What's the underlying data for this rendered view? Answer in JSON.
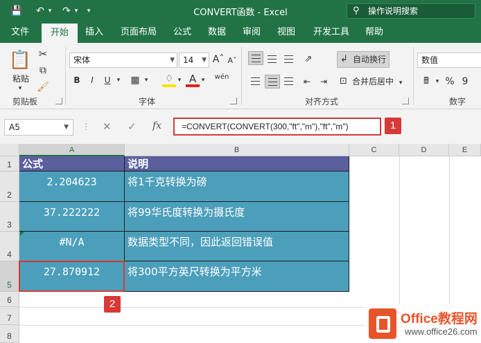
{
  "window": {
    "title": "CONVERT函数 - Excel",
    "tell_me": "操作说明搜索",
    "qat": [
      "save-icon",
      "undo-icon",
      "redo-icon",
      "customize-icon"
    ]
  },
  "ribbon": {
    "tabs": [
      "文件",
      "开始",
      "插入",
      "页面布局",
      "公式",
      "数据",
      "审阅",
      "视图",
      "开发工具",
      "帮助"
    ],
    "active_tab": "开始",
    "clipboard": {
      "paste": "粘贴",
      "label": "剪贴板"
    },
    "font": {
      "name": "宋体",
      "size": "14",
      "label": "字体",
      "bold": "B",
      "italic": "I",
      "underline": "U",
      "font_color": "A",
      "phonetic": "wén"
    },
    "alignment": {
      "wrap": "自动换行",
      "merge": "合并后居中",
      "label": "对齐方式"
    },
    "number": {
      "format": "数值",
      "percent": "%",
      "comma": "9",
      "label": "数字"
    }
  },
  "formula_bar": {
    "name_box": "A5",
    "fx": "fx",
    "formula": "=CONVERT(CONVERT(300,\"ft\",\"m\"),\"ft\",\"m\")",
    "badge": "1"
  },
  "sheet": {
    "columns": [
      "A",
      "B",
      "C",
      "D",
      "E"
    ],
    "rows": [
      "1",
      "2",
      "3",
      "4",
      "5",
      "6",
      "7",
      "8"
    ],
    "header": {
      "a": "公式",
      "b": "说明"
    },
    "data": [
      {
        "a": "2.204623",
        "b": "将1千克转换为磅"
      },
      {
        "a": "37.222222",
        "b": "将99华氏度转换为摄氏度"
      },
      {
        "a": "#N/A",
        "b": "数据类型不同，因此返回错误值"
      },
      {
        "a": "27.870912",
        "b": "将300平方英尺转换为平方米"
      }
    ],
    "badge": "2",
    "selected_cell": "A5"
  },
  "watermark": {
    "brand": "Office教程网",
    "url": "www.office26.com"
  }
}
